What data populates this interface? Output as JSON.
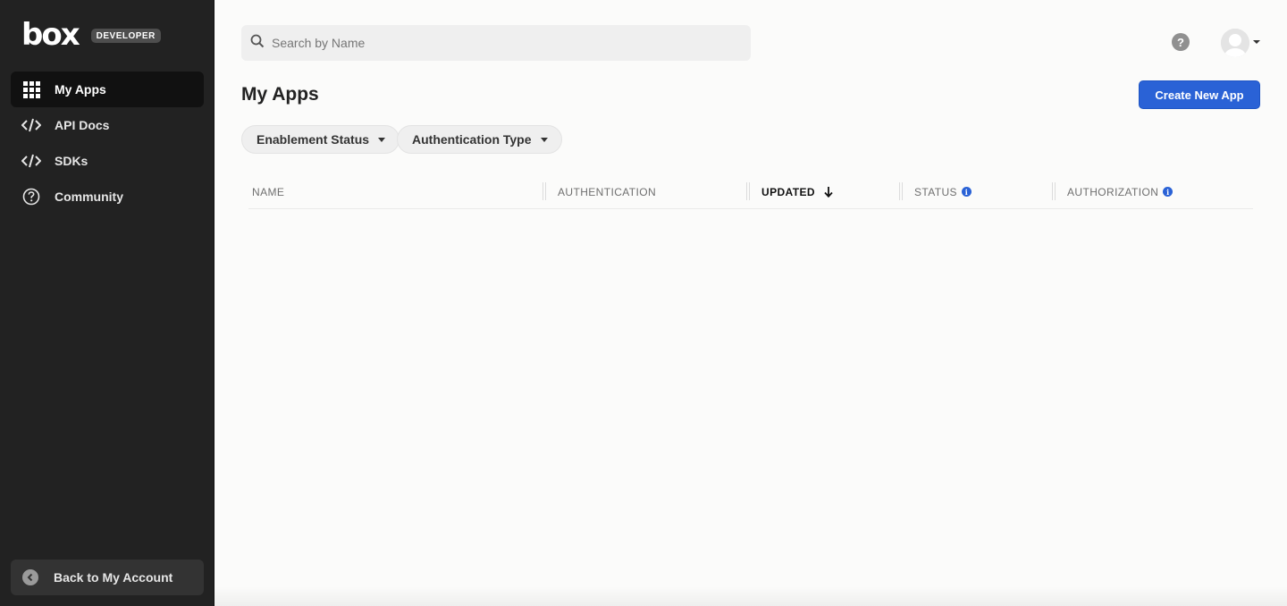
{
  "brand": {
    "logo_text": "box",
    "badge": "DEVELOPER"
  },
  "sidebar": {
    "items": [
      {
        "label": "My Apps",
        "icon": "grid-icon",
        "active": true
      },
      {
        "label": "API Docs",
        "icon": "code-icon"
      },
      {
        "label": "SDKs",
        "icon": "code-icon"
      },
      {
        "label": "Community",
        "icon": "question-circle-icon"
      }
    ],
    "back_label": "Back to My Account"
  },
  "search": {
    "placeholder": "Search by Name",
    "value": ""
  },
  "page": {
    "title": "My Apps",
    "create_button": "Create New App"
  },
  "filters": [
    {
      "label": "Enablement Status"
    },
    {
      "label": "Authentication Type"
    }
  ],
  "table": {
    "columns": [
      {
        "label": "NAME"
      },
      {
        "label": "AUTHENTICATION"
      },
      {
        "label": "UPDATED",
        "sorted": "descending"
      },
      {
        "label": "STATUS",
        "info": true
      },
      {
        "label": "AUTHORIZATION",
        "info": true
      }
    ],
    "rows": []
  },
  "colors": {
    "sidebar_bg": "#222222",
    "accent": "#2a62d6",
    "page_bg": "#fbfbfa"
  }
}
